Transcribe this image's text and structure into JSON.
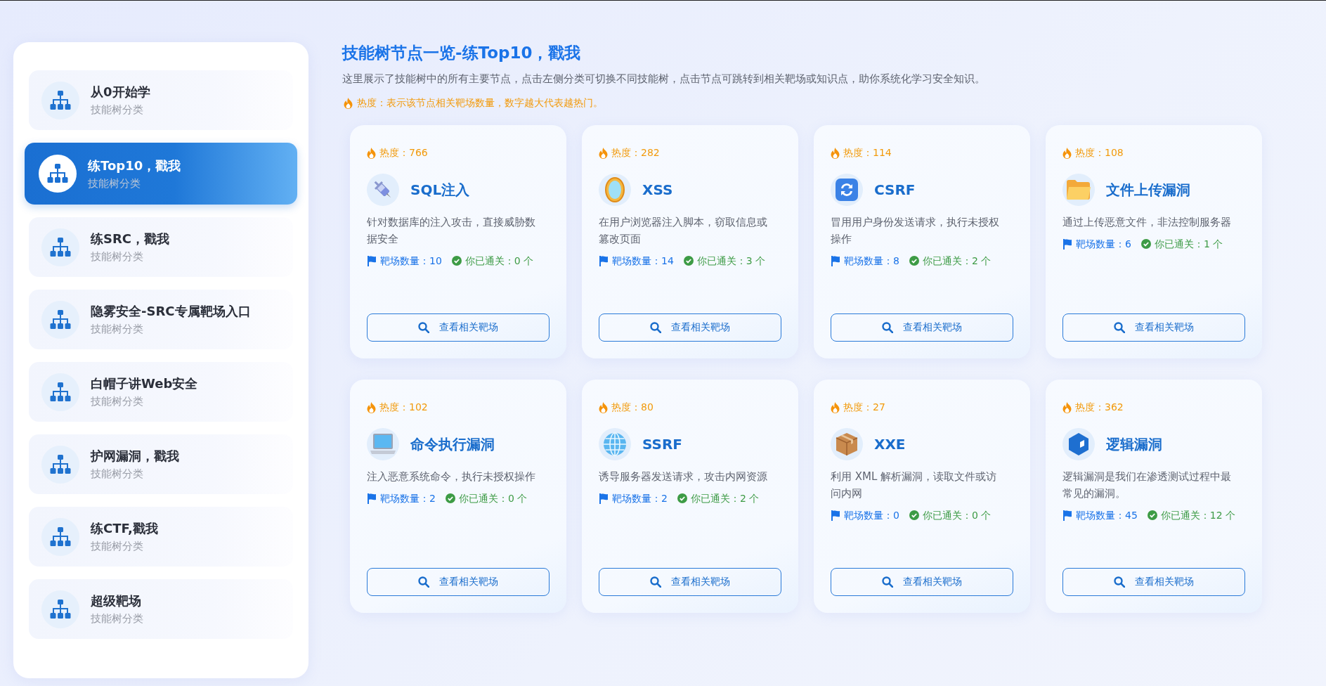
{
  "sidebar": {
    "items": [
      {
        "title": "从0开始学",
        "subtitle": "技能树分类",
        "selected": false
      },
      {
        "title": "练Top10，戳我",
        "subtitle": "技能树分类",
        "selected": true
      },
      {
        "title": "练SRC，戳我",
        "subtitle": "技能树分类",
        "selected": false
      },
      {
        "title": "隐雾安全-SRC专属靶场入口",
        "subtitle": "技能树分类",
        "selected": false
      },
      {
        "title": "白帽子讲Web安全",
        "subtitle": "技能树分类",
        "selected": false
      },
      {
        "title": "护网漏洞，戳我",
        "subtitle": "技能树分类",
        "selected": false
      },
      {
        "title": "练CTF,戳我",
        "subtitle": "技能树分类",
        "selected": false
      },
      {
        "title": "超级靶场",
        "subtitle": "技能树分类",
        "selected": false
      }
    ]
  },
  "header": {
    "title": "技能树节点一览-练Top10，戳我",
    "description": "这里展示了技能树中的所有主要节点，点击左侧分类可切换不同技能树，点击节点可跳转到相关靶场或知识点，助你系统化学习安全知识。",
    "hot_note": "热度：表示该节点相关靶场数量，数字越大代表越热门。"
  },
  "cards": [
    {
      "heat": "热度：766",
      "title": "SQL注入",
      "description": "针对数据库的注入攻击，直接威胁数据安全",
      "ranges": "靶场数量：10",
      "passed": "你已通关：0 个",
      "button": "查看相关靶场"
    },
    {
      "heat": "热度：282",
      "title": "XSS",
      "description": "在用户浏览器注入脚本，窃取信息或篡改页面",
      "ranges": "靶场数量：14",
      "passed": "你已通关：3 个",
      "button": "查看相关靶场"
    },
    {
      "heat": "热度：114",
      "title": "CSRF",
      "description": "冒用用户身份发送请求，执行未授权操作",
      "ranges": "靶场数量：8",
      "passed": "你已通关：2 个",
      "button": "查看相关靶场"
    },
    {
      "heat": "热度：108",
      "title": "文件上传漏洞",
      "description": "通过上传恶意文件，非法控制服务器",
      "ranges": "靶场数量：6",
      "passed": "你已通关：1 个",
      "button": "查看相关靶场"
    },
    {
      "heat": "热度：102",
      "title": "命令执行漏洞",
      "description": "注入恶意系统命令，执行未授权操作",
      "ranges": "靶场数量：2",
      "passed": "你已通关：0 个",
      "button": "查看相关靶场"
    },
    {
      "heat": "热度：80",
      "title": "SSRF",
      "description": "诱导服务器发送请求，攻击内网资源",
      "ranges": "靶场数量：2",
      "passed": "你已通关：2 个",
      "button": "查看相关靶场"
    },
    {
      "heat": "热度：27",
      "title": "XXE",
      "description": "利用 XML 解析漏洞，读取文件或访问内网",
      "ranges": "靶场数量：0",
      "passed": "你已通关：0 个",
      "button": "查看相关靶场"
    },
    {
      "heat": "热度：362",
      "title": "逻辑漏洞",
      "description": "逻辑漏洞是我们在渗透测试过程中最常见的漏洞。",
      "ranges": "靶场数量：45",
      "passed": "你已通关：12 个",
      "button": "查看相关靶场"
    }
  ]
}
